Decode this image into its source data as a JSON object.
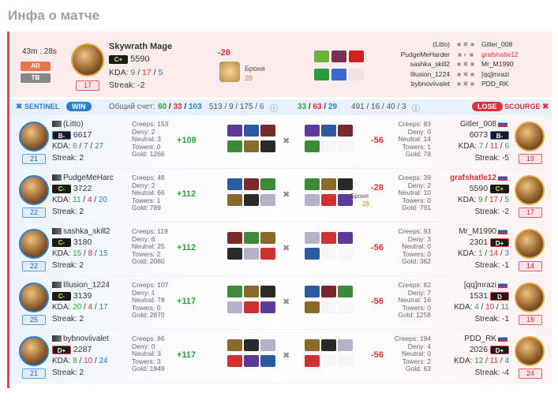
{
  "title": "Инфа о матче",
  "header": {
    "duration": "43m : 28s",
    "mode1": "AR",
    "mode2": "TB",
    "hero": "Skywrath Mage",
    "rank": "C+",
    "mmr": "5590",
    "kda_label": "KDA:",
    "kda": [
      "9",
      "17",
      "5"
    ],
    "streak": "Streak: -2",
    "level": "17",
    "mmr_change": "-28",
    "armor_label": "Броня",
    "armor_value": "28",
    "players": [
      {
        "left": "(Litto)",
        "right": "Gitler_008"
      },
      {
        "left": "PudgeMeHarder",
        "right": "grafshatle12"
      },
      {
        "left": "sashka_skill2",
        "right": "Mr_M1990"
      },
      {
        "left": "Illusion_1224",
        "right": "[qq]mrazi"
      },
      {
        "left": "bybnoviivalet",
        "right": "PDD_RK"
      }
    ]
  },
  "score": {
    "sentinel": "SENTINEL",
    "win": "WIN",
    "total_label": "Общий счет:",
    "total": [
      "60",
      "33",
      "103"
    ],
    "sent_extra": "513 / 9 / 175 / 6",
    "scourge_score": [
      "33",
      "63",
      "29"
    ],
    "scourge_extra": "491 / 16 / 40 / 3",
    "lose": "LOSE",
    "scourge": "SCOURGE"
  },
  "rows": [
    {
      "l_name": "(Litto)",
      "l_rank": "B-",
      "l_mmr": "6617",
      "l_kda": [
        "6",
        "7",
        "27"
      ],
      "l_streak": "Streak: 2",
      "l_level": "21",
      "l_creeps": "Creeps: 153",
      "l_deny": "Deny: 2",
      "l_neutral": "Neutral: 3",
      "l_towers": "Towers: 0",
      "l_gold": "Gold: 1266",
      "l_delta": "+108",
      "r_name": "Gitler_008",
      "r_rank": "B-",
      "r_mmr": "6073",
      "r_kda": [
        "7",
        "11",
        "6"
      ],
      "r_streak": "Streak: -5",
      "r_level": "19",
      "r_creeps": "Creeps: 83",
      "r_deny": "Deny: 0",
      "r_neutral": "Neutral: 14",
      "r_towers": "Towers: 1",
      "r_gold": "Gold: 78",
      "r_delta": "-56",
      "armor": ""
    },
    {
      "l_name": "PudgeMeHarc",
      "l_rank": "C-",
      "l_mmr": "3722",
      "l_kda": [
        "11",
        "4",
        "20"
      ],
      "l_streak": "Streak: 2",
      "l_level": "22",
      "l_creeps": "Creeps: 48",
      "l_deny": "Deny: 2",
      "l_neutral": "Neutral: 66",
      "l_towers": "Towers: 1",
      "l_gold": "Gold: 789",
      "l_delta": "+112",
      "r_name": "grafshatle12",
      "r_rank": "C+",
      "r_mmr": "5590",
      "r_kda": [
        "9",
        "17",
        "5"
      ],
      "r_streak": "Streak: -2",
      "r_level": "17",
      "r_creeps": "Creeps: 39",
      "r_deny": "Deny: 2",
      "r_neutral": "Neutral: 10",
      "r_towers": "Towers: 0",
      "r_gold": "Gold: 791",
      "r_delta": "-28",
      "armor": "Броня",
      "armor_v": "28"
    },
    {
      "l_name": "sashka_skill2",
      "l_rank": "C-",
      "l_mmr": "3180",
      "l_kda": [
        "15",
        "8",
        "15"
      ],
      "l_streak": "Streak: 2",
      "l_level": "22",
      "l_creeps": "Creeps: 119",
      "l_deny": "Deny: 6",
      "l_neutral": "Neutral: 25",
      "l_towers": "Towers: 2",
      "l_gold": "Gold: 2080",
      "l_delta": "+112",
      "r_name": "Mr_M1990",
      "r_rank": "D+",
      "r_mmr": "2301",
      "r_kda": [
        "1",
        "14",
        "3"
      ],
      "r_streak": "Streak: -1",
      "r_level": "14",
      "r_creeps": "Creeps: 93",
      "r_deny": "Deny: 3",
      "r_neutral": "Neutral: 0",
      "r_towers": "Towers: 0",
      "r_gold": "Gold: 362",
      "r_delta": "-56",
      "armor": ""
    },
    {
      "l_name": "Illusion_1224",
      "l_rank": "C-",
      "l_mmr": "3139",
      "l_kda": [
        "20",
        "4",
        "17"
      ],
      "l_streak": "Streak: 2",
      "l_level": "25",
      "l_creeps": "Creeps: 107",
      "l_deny": "Deny: 1",
      "l_neutral": "Neutral: 78",
      "l_towers": "Towers: 0",
      "l_gold": "Gold: 2870",
      "l_delta": "+117",
      "r_name": "[qq]mrazi",
      "r_rank": "D",
      "r_mmr": "1531",
      "r_kda": [
        "4",
        "10",
        "11"
      ],
      "r_streak": "Streak: -1",
      "r_level": "18",
      "r_creeps": "Creeps: 82",
      "r_deny": "Deny: 7",
      "r_neutral": "Neutral: 16",
      "r_towers": "Towers: 0",
      "r_gold": "Gold: 1258",
      "r_delta": "-56",
      "armor": ""
    },
    {
      "l_name": "bybnoviivalet",
      "l_rank": "D+",
      "l_mmr": "2287",
      "l_kda": [
        "8",
        "10",
        "24"
      ],
      "l_streak": "Streak: 2",
      "l_level": "21",
      "l_creeps": "Creeps: 86",
      "l_deny": "Deny: 0",
      "l_neutral": "Neutral: 3",
      "l_towers": "Towers: 3",
      "l_gold": "Gold: 1849",
      "l_delta": "+117",
      "r_name": "PDD_RK",
      "r_rank": "D+",
      "r_mmr": "2026",
      "r_kda": [
        "12",
        "11",
        "4"
      ],
      "r_streak": "Streak: -4",
      "r_level": "24",
      "r_creeps": "Creeps: 194",
      "r_deny": "Deny: 4",
      "r_neutral": "Neutral: 0",
      "r_towers": "Towers: 2",
      "r_gold": "Gold: 63",
      "r_delta": "-56",
      "armor": ""
    }
  ]
}
